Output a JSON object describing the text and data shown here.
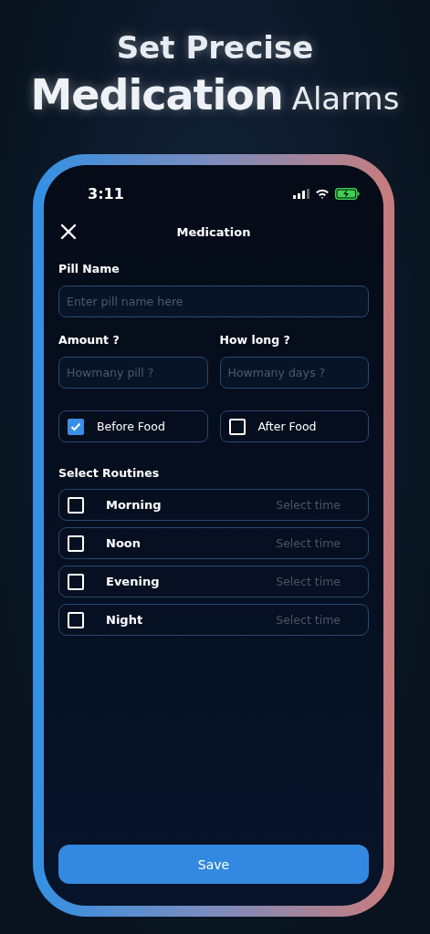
{
  "headline": {
    "line_1": "Set Precise",
    "line_2_bold": "Medication",
    "line_2_rest": "Alarms"
  },
  "status_bar": {
    "time": "3:11"
  },
  "header": {
    "title": "Medication"
  },
  "pill_name": {
    "label": "Pill Name",
    "placeholder": "Enter pill name here"
  },
  "amount": {
    "label": "Amount ?",
    "placeholder": "Howmany pill ?"
  },
  "duration": {
    "label": "How long ?",
    "placeholder": "Howmany days ?"
  },
  "food_options": [
    {
      "label": "Before Food",
      "checked": true
    },
    {
      "label": "After Food",
      "checked": false
    }
  ],
  "routines": {
    "title": "Select Routines",
    "items": [
      {
        "label": "Morning",
        "checked": false,
        "time_placeholder": "Select time"
      },
      {
        "label": "Noon",
        "checked": false,
        "time_placeholder": "Select time"
      },
      {
        "label": "Evening",
        "checked": false,
        "time_placeholder": "Select time"
      },
      {
        "label": "Night",
        "checked": false,
        "time_placeholder": "Select time"
      }
    ]
  },
  "save_button": "Save"
}
